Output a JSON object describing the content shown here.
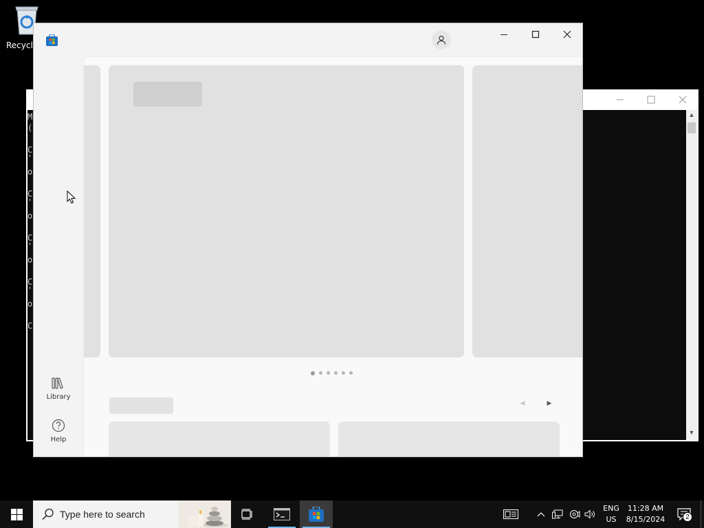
{
  "desktop": {
    "recycle_bin_label": "Recycle"
  },
  "console": {
    "side_chars": [
      "M",
      "(",
      "C",
      "'",
      "o",
      "C",
      "'",
      "o",
      "C",
      "'",
      "o",
      "C",
      "'",
      "o",
      "C"
    ]
  },
  "store": {
    "icon": "microsoft-store-icon",
    "account_icon": "person-icon",
    "window_controls": {
      "minimize": "minimize-icon",
      "maximize": "maximize-icon",
      "close": "close-icon"
    },
    "nav": [
      {
        "label": "Library",
        "icon": "library-icon"
      },
      {
        "label": "Help",
        "icon": "help-icon"
      }
    ],
    "carousel": {
      "slide_count": 6,
      "active_slide": 1
    }
  },
  "taskbar": {
    "search_placeholder": "Type here to search",
    "language_line1": "ENG",
    "language_line2": "US",
    "time": "11:28 AM",
    "date": "8/15/2024",
    "notification_count": "2",
    "accent_color": "#76b9ed"
  }
}
